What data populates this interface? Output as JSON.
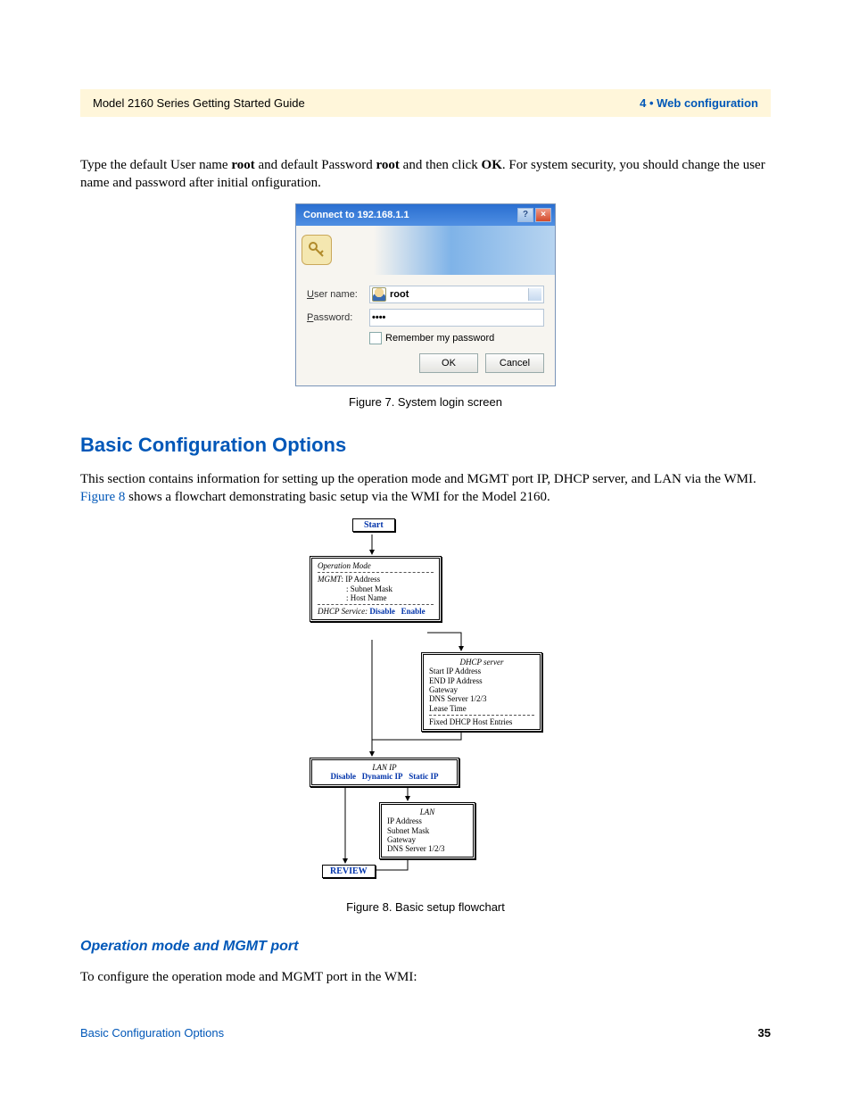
{
  "header": {
    "left": "Model 2160 Series Getting Started Guide",
    "right": "4 • Web configuration"
  },
  "intro": {
    "prefix": "Type the default User name ",
    "root1": "root",
    "mid1": " and default Password ",
    "root2": "root",
    "mid2": " and then click ",
    "ok": "OK",
    "suffix": ". For system security, you should change the user name and password after initial onfiguration."
  },
  "fig7": {
    "caption": "Figure 7. System login screen",
    "title": "Connect to 192.168.1.1",
    "help": "?",
    "close": "×",
    "username_label_pre": "U",
    "username_label_post": "ser name:",
    "username_value": "root",
    "password_label_pre": "P",
    "password_label_post": "assword:",
    "password_value": "••••",
    "remember_pre": "R",
    "remember_post": "emember my password",
    "ok_btn": "OK",
    "cancel_btn": "Cancel"
  },
  "section": {
    "heading": "Basic Configuration Options",
    "para_pre": "This section contains information for setting up the operation mode and MGMT port IP, DHCP server, and LAN via the WMI. ",
    "link": "Figure 8",
    "para_post": " shows a flowchart demonstrating basic setup via the WMI for the Model 2160."
  },
  "fig8": {
    "caption": "Figure 8. Basic setup flowchart",
    "start": "Start",
    "op_mode": "Operation Mode",
    "mgmt_label": "MGMT",
    "mgmt_ip": ": IP Address",
    "mgmt_sub": ": Subnet Mask",
    "mgmt_host": ": Host Name",
    "dhcp_svc": "DHCP Service:",
    "disable": "Disable",
    "enable": "Enable",
    "dhcp_server": "DHCP server",
    "dhcp_start": "Start IP Address",
    "dhcp_end": "END IP Address",
    "dhcp_gw": "Gateway",
    "dhcp_dns": "DNS Server 1/2/3",
    "dhcp_lease": "Lease Time",
    "dhcp_fixed": "Fixed DHCP Host Entries",
    "lan_ip": "LAN IP",
    "lan_disable": "Disable",
    "lan_dyn": "Dynamic IP",
    "lan_static": "Static IP",
    "lan": "LAN",
    "lan_addr": "IP Address",
    "lan_sub": "Subnet Mask",
    "lan_gw": "Gateway",
    "lan_dns": "DNS Server 1/2/3",
    "review": "REVIEW"
  },
  "sub": {
    "heading": "Operation mode and MGMT port",
    "text": "To configure the operation mode and MGMT port in the WMI:"
  },
  "footer": {
    "left": "Basic Configuration Options",
    "page": "35"
  }
}
